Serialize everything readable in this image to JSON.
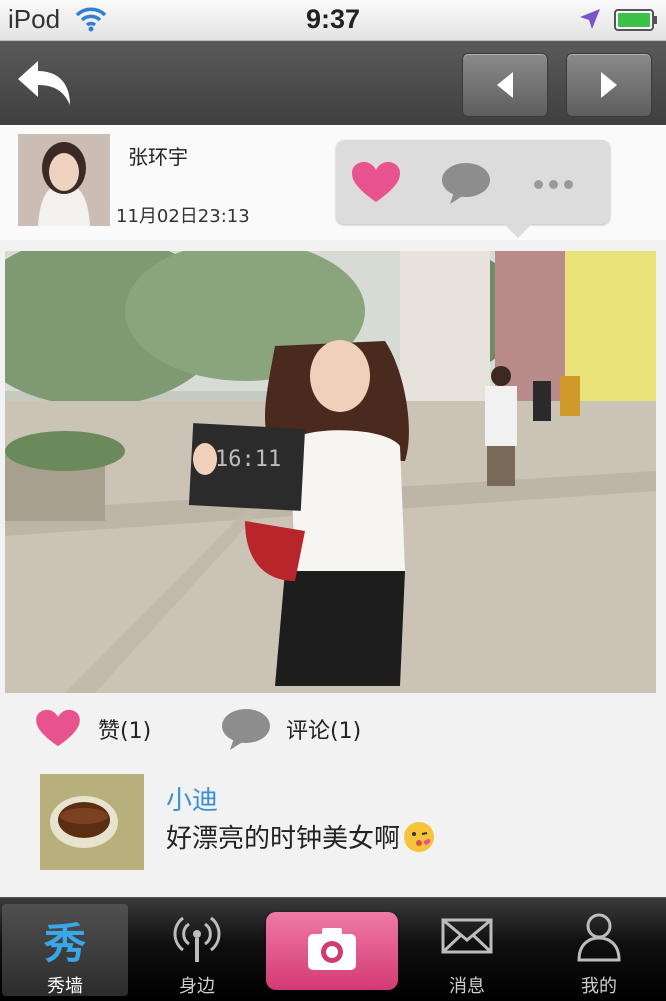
{
  "status_bar": {
    "device": "iPod",
    "time": "9:37"
  },
  "post": {
    "author": "张环宇",
    "time": "11月02日23:13",
    "photo_sign_text": "16:11"
  },
  "stats": {
    "likes_label": "赞(1)",
    "comments_label": "评论(1)"
  },
  "comments": [
    {
      "author": "小迪",
      "text": "好漂亮的时钟美女啊"
    }
  ],
  "tabs": [
    {
      "label": "秀墙",
      "glyph": "秀",
      "active": true
    },
    {
      "label": "身边"
    },
    {
      "label": "消息"
    },
    {
      "label": "我的"
    }
  ],
  "colors": {
    "accent_pink": "#e8538f",
    "link_blue": "#3a8fd6",
    "tab_active_blue": "#3aa7e8"
  },
  "icons": [
    "wifi-icon",
    "location-icon",
    "battery-icon",
    "back-arrow-icon",
    "chevron-left-icon",
    "chevron-right-icon",
    "heart-icon",
    "speech-bubble-icon",
    "more-dots-icon",
    "antenna-icon",
    "camera-icon",
    "envelope-icon",
    "person-icon"
  ]
}
